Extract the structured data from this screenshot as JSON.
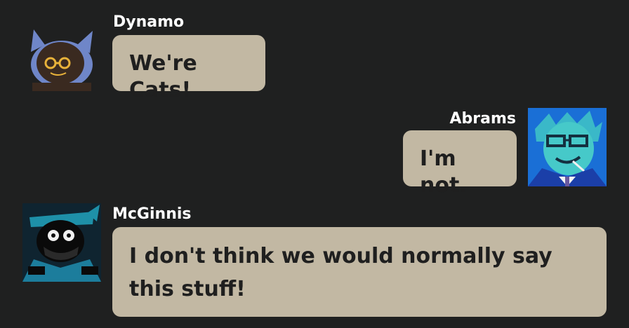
{
  "messages": [
    {
      "sender": "Dynamo",
      "text": "We're Cats!",
      "side": "left",
      "avatar_icon": "cat-eared-avatar-icon"
    },
    {
      "sender": "Abrams",
      "text": "I'm not.",
      "side": "right",
      "avatar_icon": "glasses-man-avatar-icon"
    },
    {
      "sender": "McGinnis",
      "text": "I don't think we would normally say this stuff!",
      "side": "left",
      "avatar_icon": "bandana-man-avatar-icon"
    }
  ],
  "colors": {
    "background": "#1f2020",
    "bubble": "#c2b8a3",
    "bubble_text": "#1f1f1f",
    "name_text": "#ffffff"
  }
}
